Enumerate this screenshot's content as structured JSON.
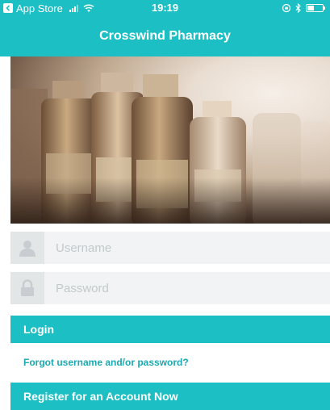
{
  "status_bar": {
    "back_app": "App Store",
    "time": "19:19",
    "battery_level": 0.45
  },
  "nav": {
    "title": "Crosswind Pharmacy"
  },
  "hero": {
    "alt": "Apothecary bottles"
  },
  "login_form": {
    "username_placeholder": "Username",
    "password_placeholder": "Password",
    "login_label": "Login",
    "forgot_label": "Forgot username and/or password?",
    "register_label": "Register for an Account Now"
  },
  "colors": {
    "accent": "#1cbfc4",
    "link": "#1aa9b3",
    "field_bg": "#f1f3f4",
    "icon_box": "#e3e6e7"
  }
}
